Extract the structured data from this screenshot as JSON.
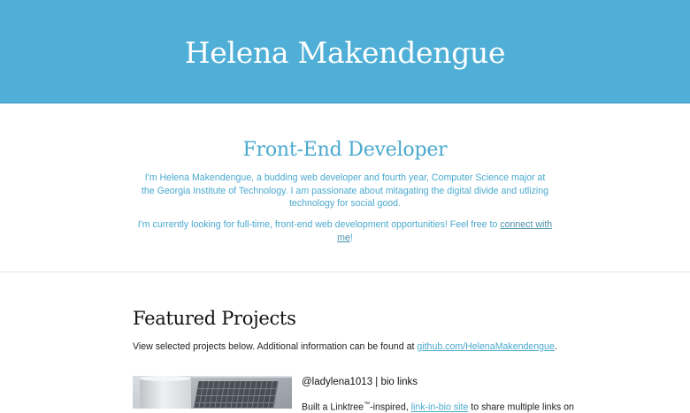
{
  "header": {
    "title": "Helena Makendengue"
  },
  "intro": {
    "heading": "Front-End Developer",
    "paragraph1": "I'm Helena Makendengue, a budding web developer and fourth year, Computer Science major at the Georgia Institute of Technology. I am passionate about mitagating the digital divide and utlizing technology for social good.",
    "paragraph2_before": "I'm currently looking for full-time, front-end web development opportunities! Feel free to ",
    "paragraph2_link": "connect with me",
    "paragraph2_after": "!"
  },
  "projects": {
    "heading": "Featured Projects",
    "description_before": "View selected projects below. Additional information can be found at ",
    "description_link": "github.com/HelenaMakendengue",
    "description_after": ".",
    "items": [
      {
        "title": "@ladylena1013 | bio links",
        "desc_before": "Built a Linktree",
        "desc_tm": "™",
        "desc_middle": "-inspired, ",
        "desc_link": "link-in-bio site",
        "desc_after": " to share multiple links on"
      }
    ]
  },
  "colors": {
    "header_bg": "#4fafd6",
    "accent": "#4aa9cf",
    "text_dark": "#111111"
  }
}
